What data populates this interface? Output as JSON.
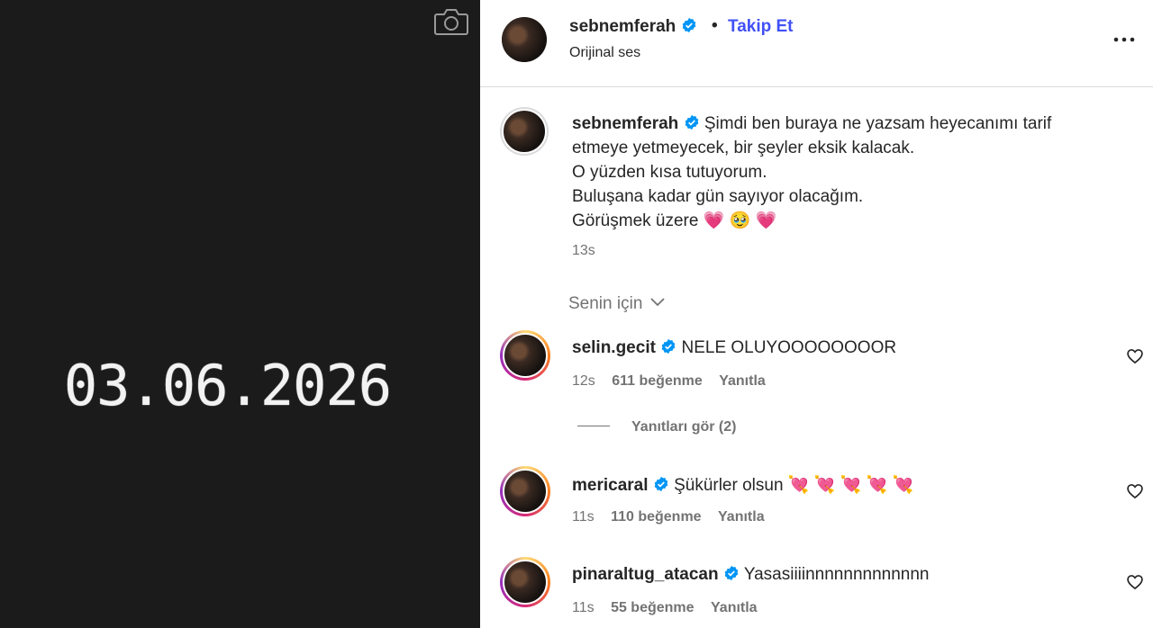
{
  "media": {
    "date_text": "03.06.2026",
    "icons": {
      "camera": "camera-icon"
    }
  },
  "post_header": {
    "username": "sebnemferah",
    "separator": "•",
    "follow_label": "Takip Et",
    "audio": "Orijinal ses",
    "icons": {
      "verified": "verified-badge-icon",
      "more": "more-options-icon"
    }
  },
  "caption": {
    "username": "sebnemferah",
    "lines": [
      "Şimdi ben buraya ne yazsam heyecanımı tarif",
      "etmeye yetmeyecek, bir şeyler eksik kalacak.",
      "O yüzden kısa tutuyorum.",
      "Buluşana kadar gün sayıyor olacağım.",
      "Görüşmek üzere 💗 🥹 💗"
    ],
    "time": "13s"
  },
  "filter": {
    "label": "Senin için",
    "icon": "chevron-down-icon"
  },
  "comments": [
    {
      "username": "selin.gecit",
      "text": "NELE OLUYOOOOOOOOR",
      "time": "12s",
      "likes": "611 beğenme",
      "reply": "Yanıtla"
    },
    {
      "username": "mericaral",
      "text": "Şükürler olsun 💘 💘 💘 💘 💘",
      "time": "11s",
      "likes": "110 beğenme",
      "reply": "Yanıtla"
    },
    {
      "username": "pinaraltug_atacan",
      "text": "Yasasiiiinnnnnnnnnnnnn",
      "time": "11s",
      "likes": "55 beğenme",
      "reply": "Yanıtla"
    }
  ],
  "view_replies": "Yanıtları gör (2)",
  "colors": {
    "follow_blue": "#4150f7",
    "verified_blue": "#0095f6",
    "muted": "#737373",
    "media_bg": "#1b1b1b"
  }
}
